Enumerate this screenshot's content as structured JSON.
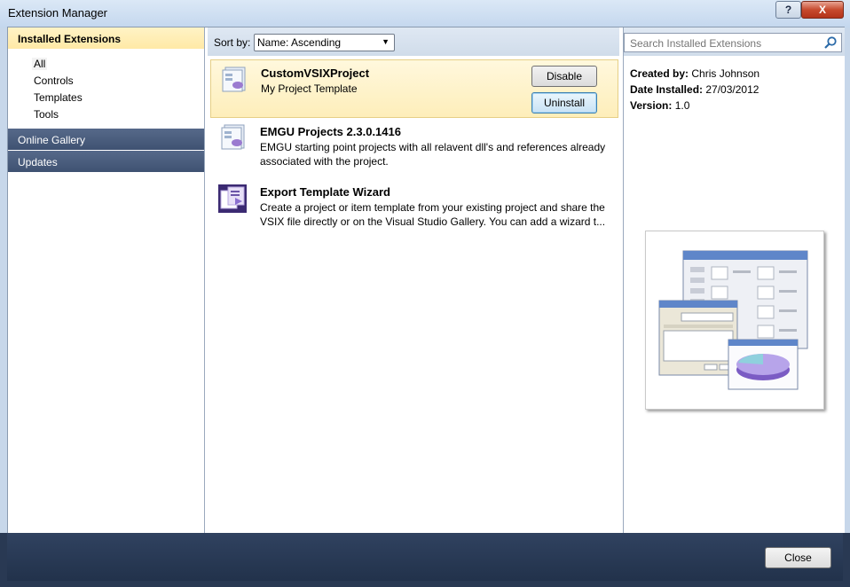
{
  "window": {
    "title": "Extension Manager",
    "help_label": "?",
    "close_label": "X"
  },
  "sidebar": {
    "installed_header": "Installed Extensions",
    "sub_items": [
      "All",
      "Controls",
      "Templates",
      "Tools"
    ],
    "online_gallery": "Online Gallery",
    "updates": "Updates"
  },
  "toolbar": {
    "sort_label": "Sort by:",
    "sort_value": "Name: Ascending"
  },
  "search": {
    "placeholder": "Search Installed Extensions"
  },
  "extensions": [
    {
      "name": "CustomVSIXProject",
      "description": "My Project Template",
      "disable_label": "Disable",
      "uninstall_label": "Uninstall"
    },
    {
      "name": "EMGU Projects 2.3.0.1416",
      "description_line1": "EMGU starting point projects with all relavent dll's and references already",
      "description_line2": "associated with the project."
    },
    {
      "name": "Export Template Wizard",
      "description_line1": "Create a project or item template from your existing project and share the",
      "description_line2": "VSIX file directly or on the Visual Studio Gallery.  You can add a wizard t..."
    }
  ],
  "details": {
    "created_by_label": "Created by:",
    "created_by_value": "Chris Johnson",
    "date_installed_label": "Date Installed:",
    "date_installed_value": "27/03/2012",
    "version_label": "Version:",
    "version_value": "1.0"
  },
  "footer": {
    "close_label": "Close"
  },
  "colors": {
    "selected_bg": "#feeeba",
    "nav_dark": "#3f5272",
    "footer": "#293953"
  }
}
